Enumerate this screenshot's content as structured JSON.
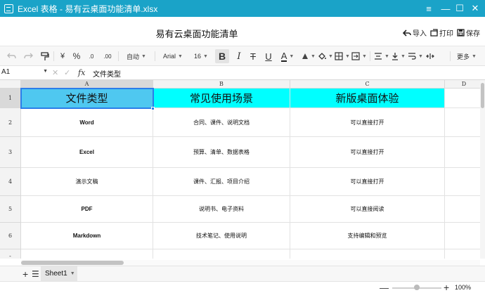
{
  "window": {
    "title": "Excel 表格 - 易有云桌面功能清单.xlsx",
    "controls": {
      "menu": "≡",
      "minimize": "—",
      "maximize": "☐",
      "close": "✕"
    }
  },
  "header": {
    "doc_title": "易有云桌面功能清单",
    "actions": {
      "import": "导入",
      "print": "打印",
      "save": "保存"
    }
  },
  "toolbar": {
    "currency": "¥",
    "percent": "%",
    "decimal_inc": ".0",
    "decimal_dec": ".00",
    "format": "自动",
    "font": "Arial",
    "font_size": "16",
    "bold": "B",
    "italic": "I",
    "strike": "T",
    "underline": "U",
    "font_color": "A",
    "more": "更多",
    "accent_color": "#1aa3c8"
  },
  "formula_bar": {
    "cell_ref": "A1",
    "fx": "fx",
    "value": "文件类型"
  },
  "grid": {
    "columns": [
      "A",
      "B",
      "C",
      "D"
    ],
    "rows": [
      "1",
      "2",
      "3",
      "4",
      "5",
      "6",
      "-"
    ],
    "header_cells": [
      "文件类型",
      "常见使用场景",
      "新版桌面体验"
    ],
    "data_rows": [
      [
        "Word",
        "合同、课件、说明文档",
        "可以直接打开"
      ],
      [
        "Excel",
        "预算、清单、数据表格",
        "可以直接打开"
      ],
      [
        "演示文稿",
        "课件、汇报、项目介绍",
        "可以直接打开"
      ],
      [
        "PDF",
        "说明书、电子资料",
        "可以直接阅读"
      ],
      [
        "Markdown",
        "技术笔记、使用说明",
        "支持编辑和预览"
      ]
    ],
    "header_fill": "#00ffff",
    "selected_fill": "#4fc8f0"
  },
  "sheets": {
    "add": "+",
    "list": "☰",
    "active": "Sheet1"
  },
  "status": {
    "zoom": "100%",
    "zoom_level": 1.0
  }
}
